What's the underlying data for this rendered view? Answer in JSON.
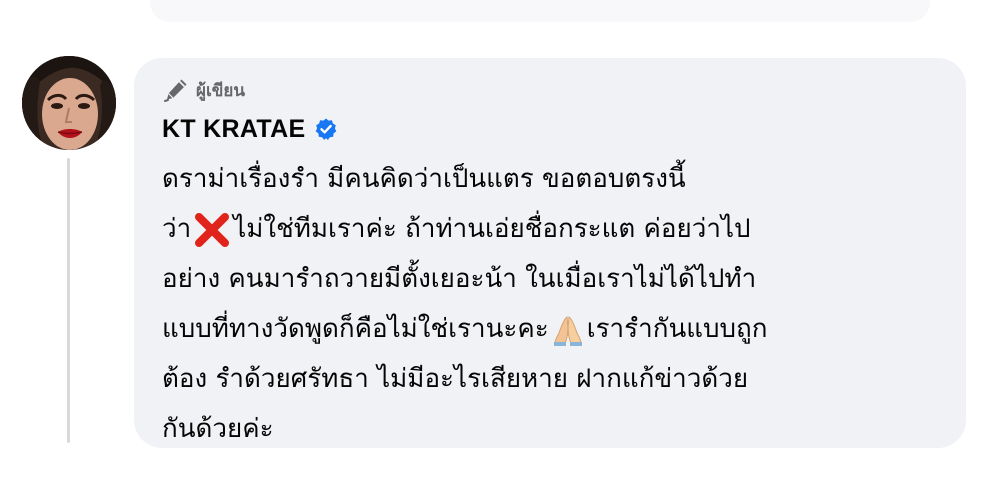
{
  "post": {
    "author_badge_label": "ผู้เขียน",
    "author_name": "KT KRATAE",
    "verified": true,
    "comment_lines": [
      {
        "a": "ดราม่าเรื่องรำ มีคนคิดว่าเป็นแตร ขอตอบตรงนี้",
        "b": ""
      },
      {
        "a": "ว่า",
        "b": "ไม่ใช่ทีมเราค่ะ ถ้าท่านเอ่ยชื่อกระแต ค่อยว่าไป"
      },
      {
        "a": "อย่าง คนมารำถวายมีตั้งเยอะน้า ในเมื่อเราไม่ได้ไปทำ",
        "b": ""
      },
      {
        "a": "แบบที่ทางวัดพูดก็คือไม่ใช่เรานะคะ",
        "b": "เรารำกันแบบถูก"
      },
      {
        "a": "ต้อง รำด้วยศรัทธา ไม่มีอะไรเสียหาย ฝากแก้ข่าวด้วย",
        "b": ""
      },
      {
        "a": "กันด้วยค่ะ",
        "b": ""
      }
    ]
  },
  "icons": {
    "author_badge": "pen-icon",
    "verified": "verified-badge-icon",
    "cross": "cross-mark-emoji",
    "pray": "folded-hands-emoji"
  },
  "colors": {
    "bubble_bg": "#f0f2f5",
    "text": "#050505",
    "secondary_text": "#65676b",
    "verified_blue": "#1877f2",
    "cross_red": "#e0241b",
    "thread_line": "#d8d9dc"
  }
}
